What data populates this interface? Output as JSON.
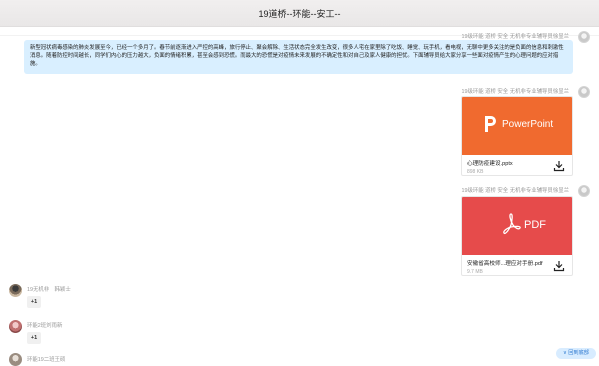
{
  "window": {
    "title": "19道桥--环能--安工--"
  },
  "messages": {
    "sender_right": "19级环能 道桥 安全 无机非专业辅导员徐显兰",
    "text_bubble": "新型冠状病毒感染的肺炎发展至今，已经一个多月了。春节前逐渐进入严控的高峰，旅行停止、聚会解除、生活状态完全发生改变，很多人宅在家里除了吃饭、睡觉、玩手机，看电视，无聊中更多关注的是负面的信息和刺激性消息。随着防控时间越长，同学们内心的压力越大，负面的情绪积累，甚至会感到恐慌。而最大的恐慌是对疫情未来发展的不确定性和对自己及家人健康的担忧。下面辅导员给大家分享一些面对疫情产生的心理问题的应对措施。",
    "file1": {
      "name": "心理防疫建设.pptx",
      "size": "898 KB",
      "banner_label": "PowerPoint"
    },
    "file2": {
      "name": "安徽省高校师...理应对手册.pdf",
      "size": "9.7 MB",
      "banner_label": "PDF"
    }
  },
  "reactions": [
    {
      "sender": "19无机非　韩颖士",
      "label": "+1"
    },
    {
      "sender": "环能2班刘雨新",
      "label": "+1"
    },
    {
      "sender": "环能19二班王硕"
    }
  ],
  "back_bottom": {
    "label": "∨ 回到底部"
  },
  "colors": {
    "bubble": "#d9efff",
    "ppt": "#f06a2f",
    "pdf": "#e64b4b",
    "accent": "#2f7ad1"
  }
}
